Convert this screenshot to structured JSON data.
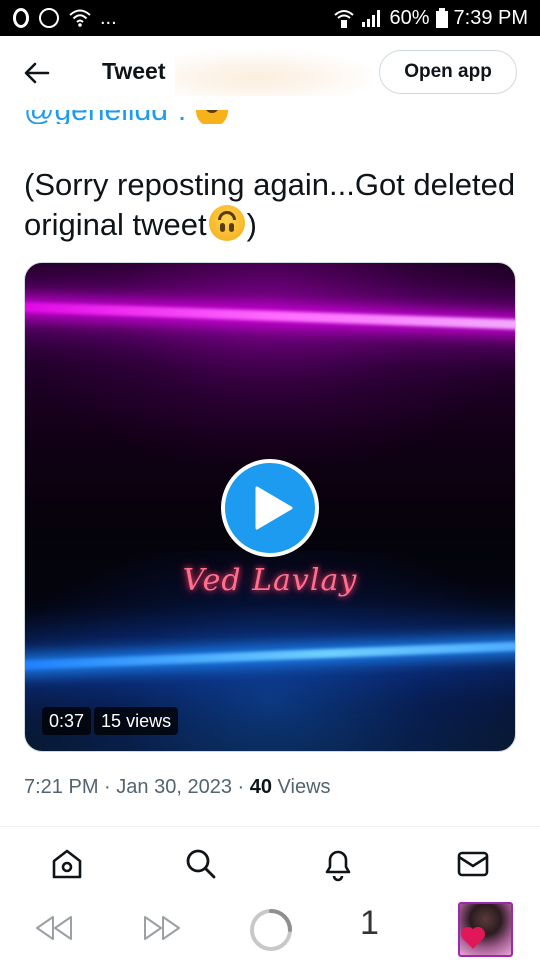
{
  "status_bar": {
    "battery": "60%",
    "time": "7:39 PM",
    "ellipsis": "...",
    "b_badge": "B"
  },
  "header": {
    "title": "Tweet",
    "open_app_label": "Open app"
  },
  "tweet": {
    "handle": "@genelidd",
    "text_part1": "(Sorry reposting again...Got deleted original tweet",
    "text_part2": ")",
    "video": {
      "signature": "Ved Lavlay",
      "duration": "0:37",
      "views": "15 views"
    },
    "meta": {
      "time": "7:21 PM",
      "date": "Jan 30, 2023",
      "separator": "·",
      "view_count": "40",
      "views_label": "Views"
    }
  },
  "tab_bar": {
    "icons": [
      "home-icon",
      "search-icon",
      "notifications-icon",
      "messages-icon"
    ]
  },
  "browser_bar": {
    "tab_count": "1",
    "icons": [
      "rewind-icon",
      "fast-forward-icon",
      "loading-icon",
      "profile-avatar"
    ]
  },
  "colors": {
    "accent": "#1d9bf0",
    "text": "#0f1419",
    "secondary_text": "#536471",
    "neon_pink": "#e000e6",
    "neon_blue": "#1a7cff"
  }
}
